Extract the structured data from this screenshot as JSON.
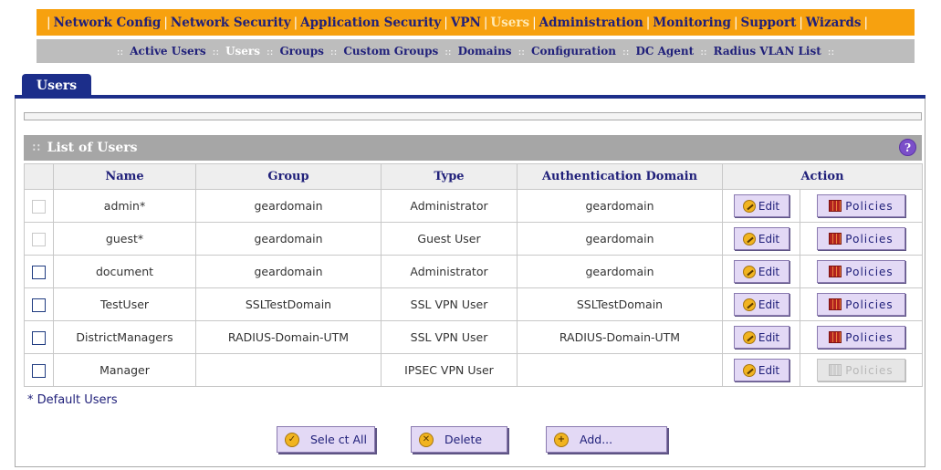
{
  "top_nav": [
    {
      "label": "Network Config",
      "active": false
    },
    {
      "label": "Network Security",
      "active": false
    },
    {
      "label": "Application Security",
      "active": false
    },
    {
      "label": "VPN",
      "active": false
    },
    {
      "label": "Users",
      "active": true
    },
    {
      "label": "Administration",
      "active": false
    },
    {
      "label": "Monitoring",
      "active": false
    },
    {
      "label": "Support",
      "active": false
    },
    {
      "label": "Wizards",
      "active": false
    }
  ],
  "sub_nav": [
    {
      "label": "Active Users",
      "active": false
    },
    {
      "label": "Users",
      "active": true
    },
    {
      "label": "Groups",
      "active": false
    },
    {
      "label": "Custom Groups",
      "active": false
    },
    {
      "label": "Domains",
      "active": false
    },
    {
      "label": "Configuration",
      "active": false
    },
    {
      "label": "DC Agent",
      "active": false
    },
    {
      "label": "Radius VLAN List",
      "active": false
    }
  ],
  "tab_label": "Users",
  "section_title": "List of Users",
  "help_glyph": "?",
  "columns": [
    "Name",
    "Group",
    "Type",
    "Authentication Domain",
    "Action"
  ],
  "users": [
    {
      "name": "admin*",
      "group": "geardomain",
      "type": "Administrator",
      "auth_domain": "geardomain",
      "checkbox_enabled": false,
      "policies_enabled": true
    },
    {
      "name": "guest*",
      "group": "geardomain",
      "type": "Guest User",
      "auth_domain": "geardomain",
      "checkbox_enabled": false,
      "policies_enabled": true
    },
    {
      "name": "document",
      "group": "geardomain",
      "type": "Administrator",
      "auth_domain": "geardomain",
      "checkbox_enabled": true,
      "policies_enabled": true
    },
    {
      "name": "TestUser",
      "group": "SSLTestDomain",
      "type": "SSL VPN User",
      "auth_domain": "SSLTestDomain",
      "checkbox_enabled": true,
      "policies_enabled": true
    },
    {
      "name": "DistrictManagers",
      "group": "RADIUS-Domain-UTM",
      "type": "SSL VPN User",
      "auth_domain": "RADIUS-Domain-UTM",
      "checkbox_enabled": true,
      "policies_enabled": true
    },
    {
      "name": "Manager",
      "group": "",
      "type": "IPSEC VPN User",
      "auth_domain": "",
      "checkbox_enabled": true,
      "policies_enabled": false
    }
  ],
  "edit_label": "Edit",
  "policies_label": "Policies",
  "default_users_note": "* Default Users",
  "buttons": {
    "select_all": "Sele ct All",
    "delete": "Delete",
    "add": "Add..."
  },
  "colors": {
    "top_nav_bg": "#f7a10f",
    "sub_nav_bg": "#bdbdbd",
    "tab_bg": "#1c2e8a",
    "section_bg": "#a6a6a6",
    "button_bg": "#e3d9f5"
  }
}
